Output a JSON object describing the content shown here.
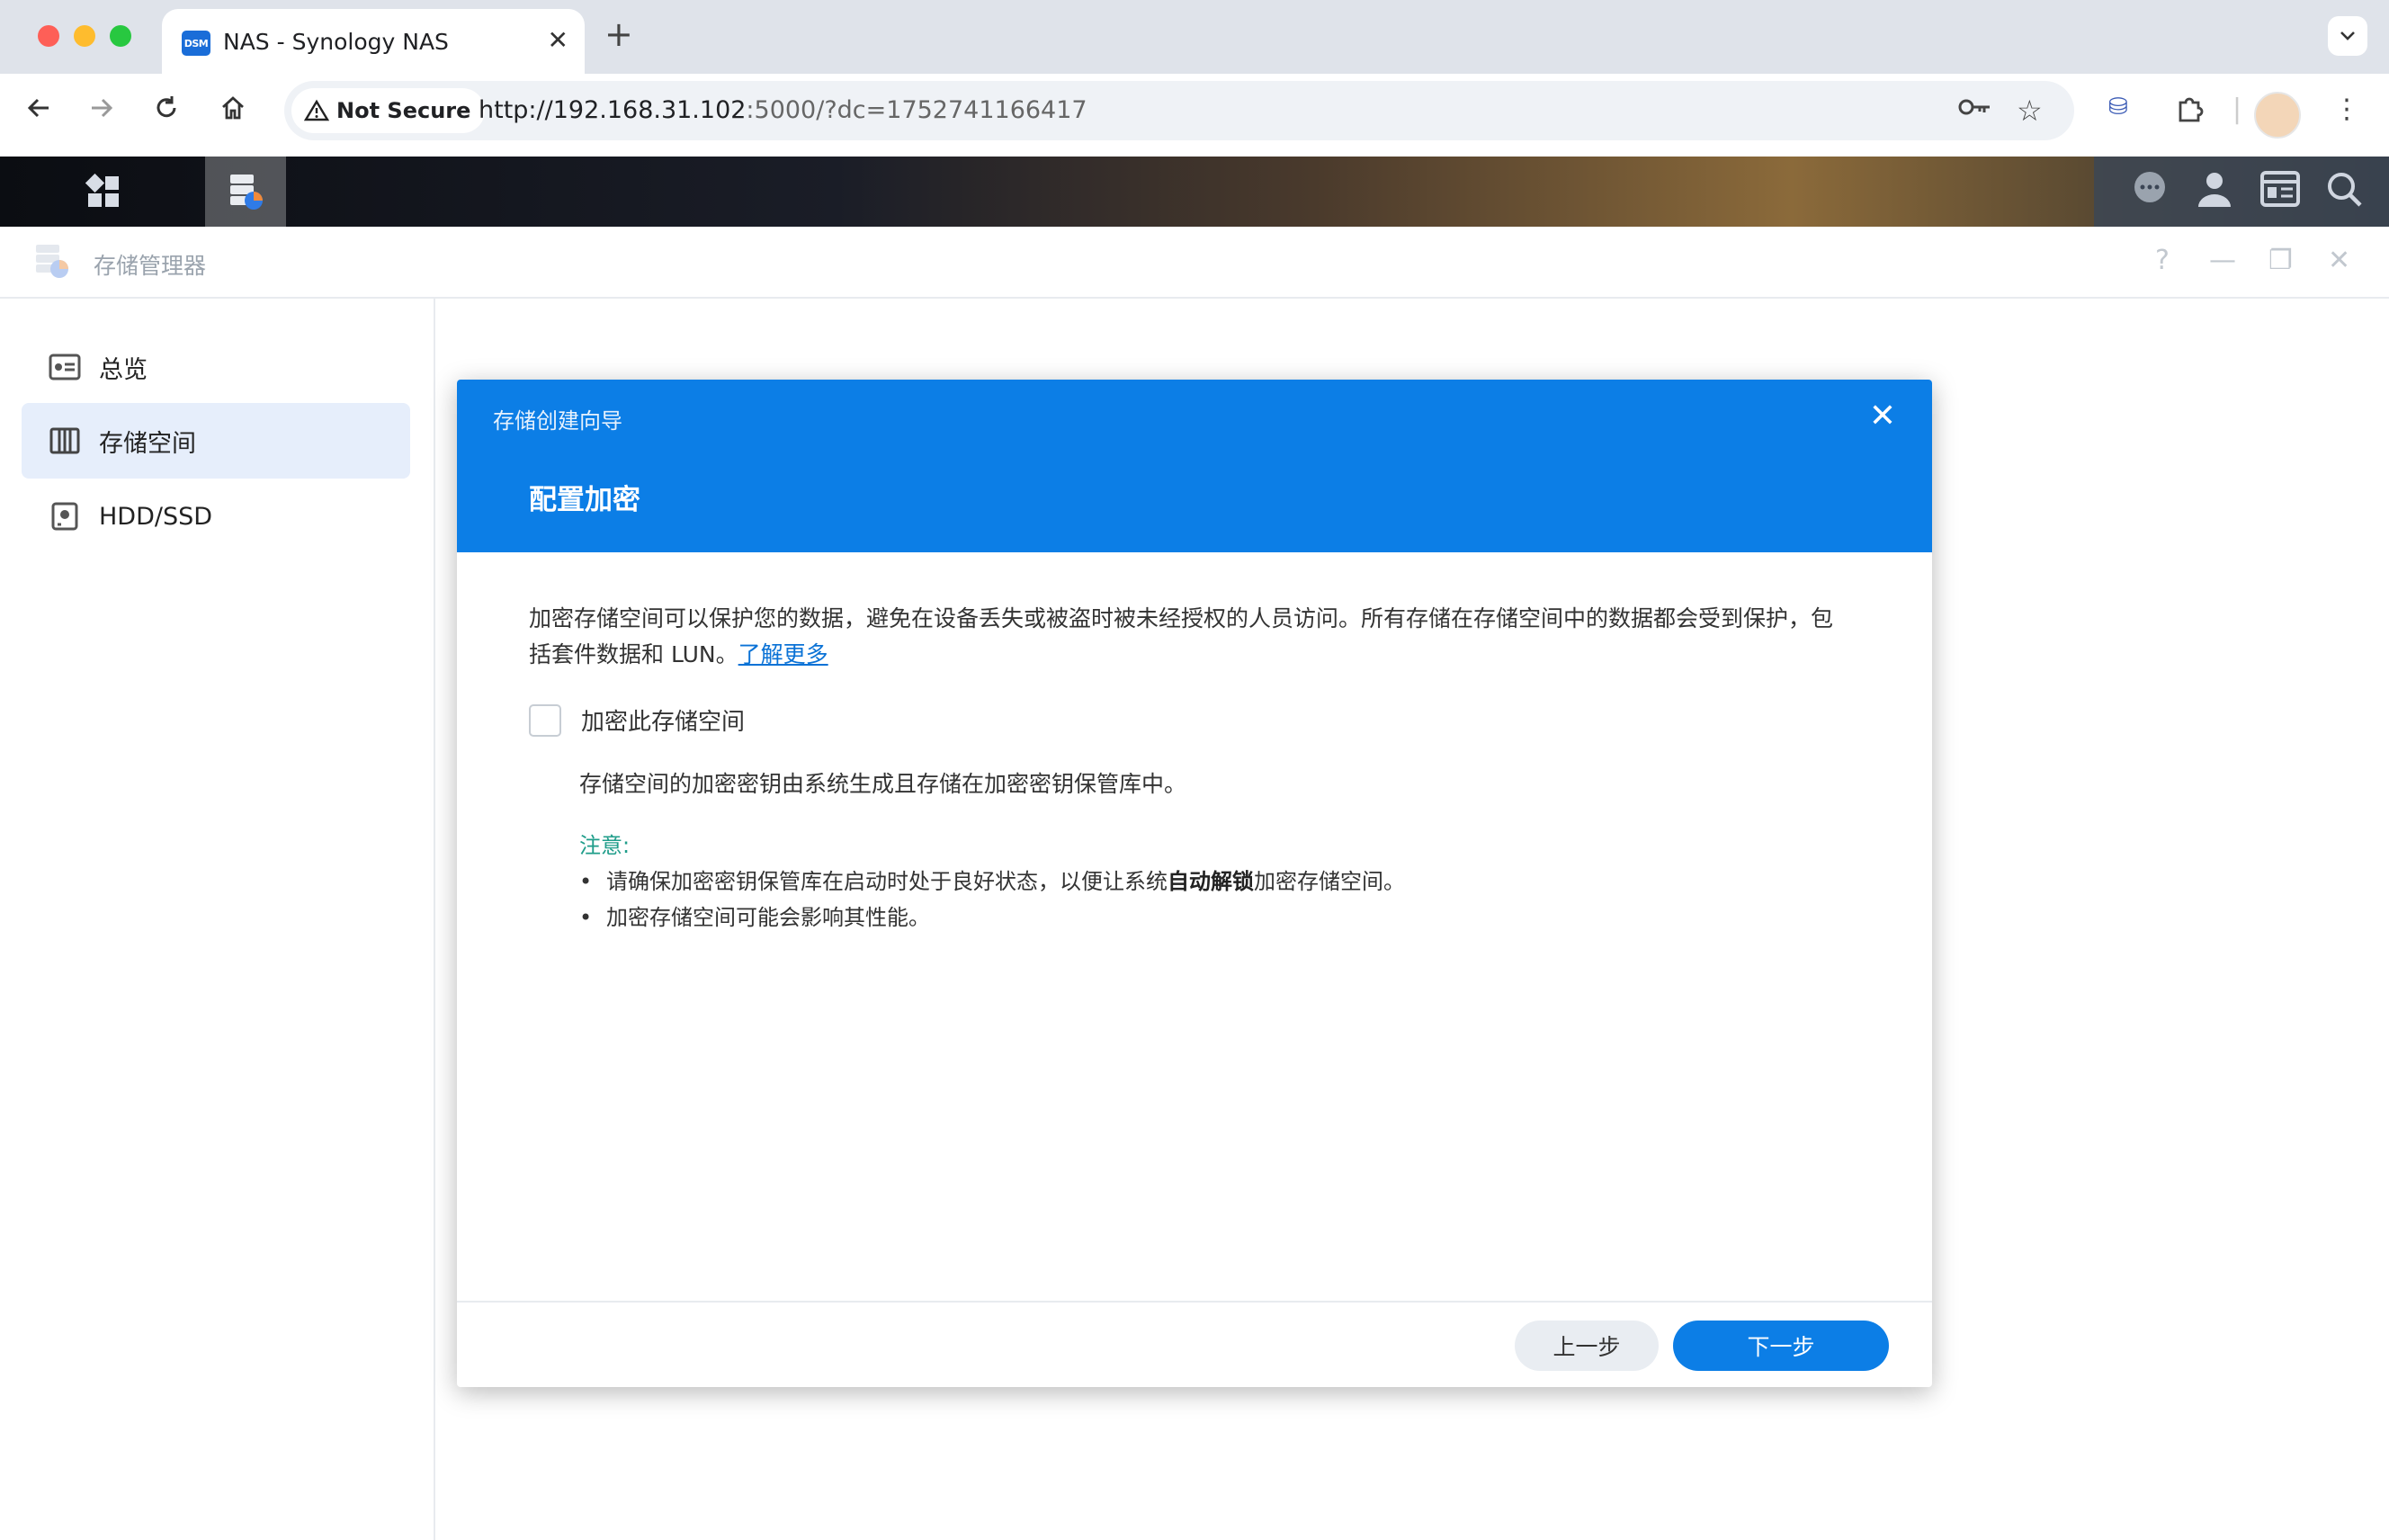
{
  "browser": {
    "tab_title": "NAS - Synology NAS",
    "favicon_text": "DSM",
    "security_label": "Not Secure",
    "url_host": "http://192.168.31.102",
    "url_rest": ":5000/?dc=1752741166417"
  },
  "app": {
    "title": "存储管理器",
    "help_icon": "?"
  },
  "sidebar": {
    "items": [
      {
        "label": "总览",
        "icon": "overview-icon"
      },
      {
        "label": "存储空间",
        "icon": "storage-pool-icon"
      },
      {
        "label": "HDD/SSD",
        "icon": "disk-icon"
      }
    ]
  },
  "dialog": {
    "wizard_title": "存储创建向导",
    "step_title": "配置加密",
    "description": "加密存储空间可以保护您的数据，避免在设备丢失或被盗时被未经授权的人员访问。所有存储在存储空间中的数据都会受到保护，包括套件数据和 LUN。",
    "learn_more": "了解更多",
    "checkbox_label": "加密此存储空间",
    "checkbox_checked": false,
    "subtext": "存储空间的加密密钥由系统生成且存储在加密密钥保管库中。",
    "note_title": "注意:",
    "note_1_before": "请确保加密密钥保管库在启动时处于良好状态，以便让系统",
    "note_1_bold": "自动解锁",
    "note_1_after": "加密存储空间。",
    "note_2": "加密存储空间可能会影响其性能。",
    "prev_button": "上一步",
    "next_button": "下一步"
  },
  "colors": {
    "accent": "#0c7ee6",
    "note": "#1f9d8a",
    "link": "#0a72d6"
  }
}
